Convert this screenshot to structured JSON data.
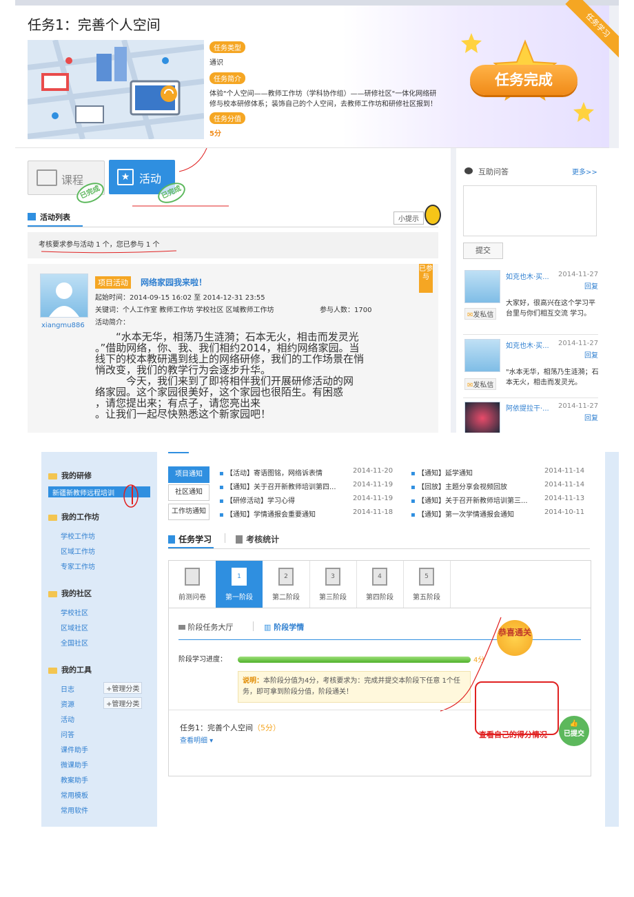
{
  "task": {
    "title": "任务1：完善个人空间",
    "type_tag": "任务类型",
    "type_value": "通识",
    "intro_tag": "任务简介",
    "intro_text_1": "体验\"个人空间——教师工作坊（学科协作组）——研修社区\"一体化网络研",
    "intro_text_2": "修与校本研修体系；装饰自己的个人空间，去教师工作坊和研修社区报到！",
    "score_tag": "任务分值",
    "score_value": "5分",
    "complete_badge": "任务完成",
    "ribbon": "任务学习"
  },
  "tabs": {
    "course": "课程",
    "activity": "活动",
    "done_stamp": "已完成"
  },
  "activity_list": {
    "title": "活动列表",
    "hint_button": "小提示",
    "requirement": "考核要求参与活动 1 个，您已参与 1 个"
  },
  "activity": {
    "project_tag": "项目活动",
    "title": "网络家园我来啦！",
    "time": "起始时间：2014-09-15 16:02 至 2014-12-31 23:55",
    "keywords": "关键词：个人工作室  教师工作坊  学校社区  区域教师工作坊",
    "participants": "参与人数：1700",
    "intro_label": "活动简介：",
    "username": "xiangmu886",
    "vert_tag": "已参与",
    "body_1": "　　“水本无华，相荡乃生涟漪；石本无火，相击而发灵光",
    "body_2": "。”借助网络，你、我、我们相约2014，相约网络家园。当",
    "body_3": "线下的校本教研遇到线上的网络研修，我们的工作场景在悄",
    "body_4": "悄改变，我们的教学行为会逐步升华。",
    "body_5": "　　　今天，我们来到了即将相伴我们开展研修活动的网",
    "body_6": "络家园。这个家园很美好，这个家园也很陌生。有困惑",
    "body_7": "，请您提出来；有点子，请您亮出来",
    "body_8": "。让我们一起尽快熟悉这个新家园吧！"
  },
  "qa": {
    "title": "互助问答",
    "more": "更多>>",
    "submit": "提交",
    "send_msg": "发私信",
    "reply": "回复",
    "comments": [
      {
        "name": "如克也木·买...",
        "date": "2014-11-27",
        "text": "大家好，很高兴在这个学习平台里与你们相互交流 学习。"
      },
      {
        "name": "如克也木·买...",
        "date": "2014-11-27",
        "text": "\"水本无华，相荡乃生涟漪；石本无火，相击而发灵光。"
      },
      {
        "name": "阿依提拉干·...",
        "date": "2014-11-27",
        "text": ""
      }
    ]
  },
  "sidebar": {
    "sections": [
      {
        "title": "我的研修",
        "items": [
          "新疆新教师远程培训"
        ]
      },
      {
        "title": "我的工作坊",
        "items": [
          "学校工作坊",
          "区域工作坊",
          "专家工作坊"
        ]
      },
      {
        "title": "我的社区",
        "items": [
          "学校社区",
          "区域社区",
          "全国社区"
        ]
      },
      {
        "title": "我的工具",
        "items": [
          "日志",
          "资源",
          "活动",
          "问答",
          "课件助手",
          "微课助手",
          "教案助手",
          "常用模板",
          "常用软件"
        ]
      }
    ],
    "manage_label": "+管理分类"
  },
  "notices": {
    "tabs": [
      "项目通知",
      "社区通知",
      "工作坊通知"
    ],
    "left": [
      {
        "title": "【活动】寄语图铭，网络诉表情",
        "date": "2014-11-20"
      },
      {
        "title": "【通知】关于召开新教师培训第四...",
        "date": "2014-11-19"
      },
      {
        "title": "【研修活动】学习心得",
        "date": "2014-11-19"
      },
      {
        "title": "【通知】学情通报会重要通知",
        "date": "2014-11-18"
      }
    ],
    "right": [
      {
        "title": "【通知】延学通知",
        "date": "2014-11-14"
      },
      {
        "title": "【回放】主题分享会视频回放",
        "date": "2014-11-14"
      },
      {
        "title": "【通知】关于召开新教师培训第三...",
        "date": "2014-11-13"
      },
      {
        "title": "【通知】第一次学情通报会通知",
        "date": "2014-10-11"
      }
    ]
  },
  "study": {
    "tab_task": "任务学习",
    "tab_stats": "考核统计",
    "stages": [
      "前测问卷",
      "第一阶段",
      "第二阶段",
      "第三阶段",
      "第四阶段",
      "第五阶段"
    ],
    "stage_numbers": [
      "",
      "1",
      "2",
      "3",
      "4",
      "5"
    ],
    "sub_tab_hall": "阶段任务大厅",
    "sub_tab_status": "阶段学情",
    "progress_label": "阶段学习进度：",
    "progress_score": "4分",
    "progress_fraction": 1.0,
    "note_label": "说明：",
    "note_text_1": "本阶段分值为4分，考核要求为：完成并提交本阶段下任意 1个任",
    "note_text_2": "务，即可拿到阶段分值，阶段通关！",
    "congrats": "恭喜通关",
    "task_name": "任务1：完善个人空间",
    "task_score": "（5分）",
    "view_detail": "查看明细",
    "check_score": "查看自己的得分情况",
    "submitted": "已提交"
  },
  "colors": {
    "accent_blue": "#2f8fe0",
    "orange": "#f5a623",
    "green": "#5cb85c",
    "annotation_red": "#e02020"
  }
}
